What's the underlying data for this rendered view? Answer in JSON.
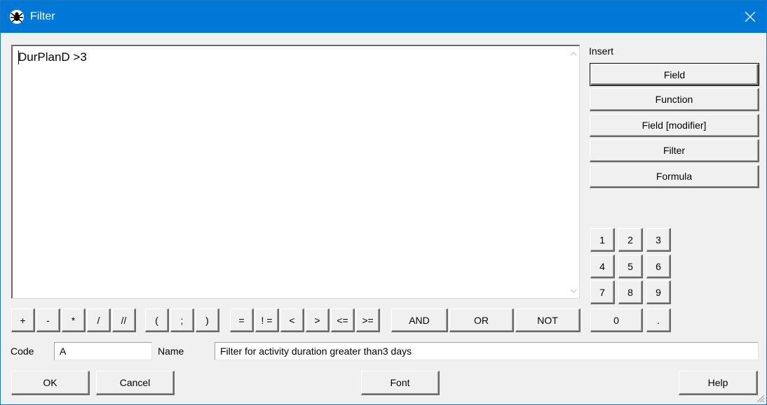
{
  "window": {
    "title": "Filter"
  },
  "editor": {
    "text": "DurPlanD >3"
  },
  "insert": {
    "label": "Insert",
    "buttons": [
      "Field",
      "Function",
      "Field [modifier]",
      "Filter",
      "Formula"
    ]
  },
  "keypad": {
    "digits": [
      "1",
      "2",
      "3",
      "4",
      "5",
      "6",
      "7",
      "8",
      "9"
    ],
    "zero": "0",
    "dot": "."
  },
  "operators": {
    "arith": [
      "+",
      "-",
      "*",
      "/",
      "//"
    ],
    "paren": [
      "(",
      ";",
      ")"
    ],
    "compare": [
      "=",
      "! =",
      "<",
      ">",
      "<=",
      ">="
    ],
    "logic": [
      "AND",
      "OR",
      "NOT"
    ]
  },
  "form": {
    "code_label": "Code",
    "code_value": "A",
    "name_label": "Name",
    "name_value": "Filter for activity duration greater than3 days"
  },
  "footer": {
    "ok": "OK",
    "cancel": "Cancel",
    "font": "Font",
    "help": "Help"
  },
  "colors": {
    "titlebar": "#0078d7",
    "background": "#f0f0f0"
  }
}
